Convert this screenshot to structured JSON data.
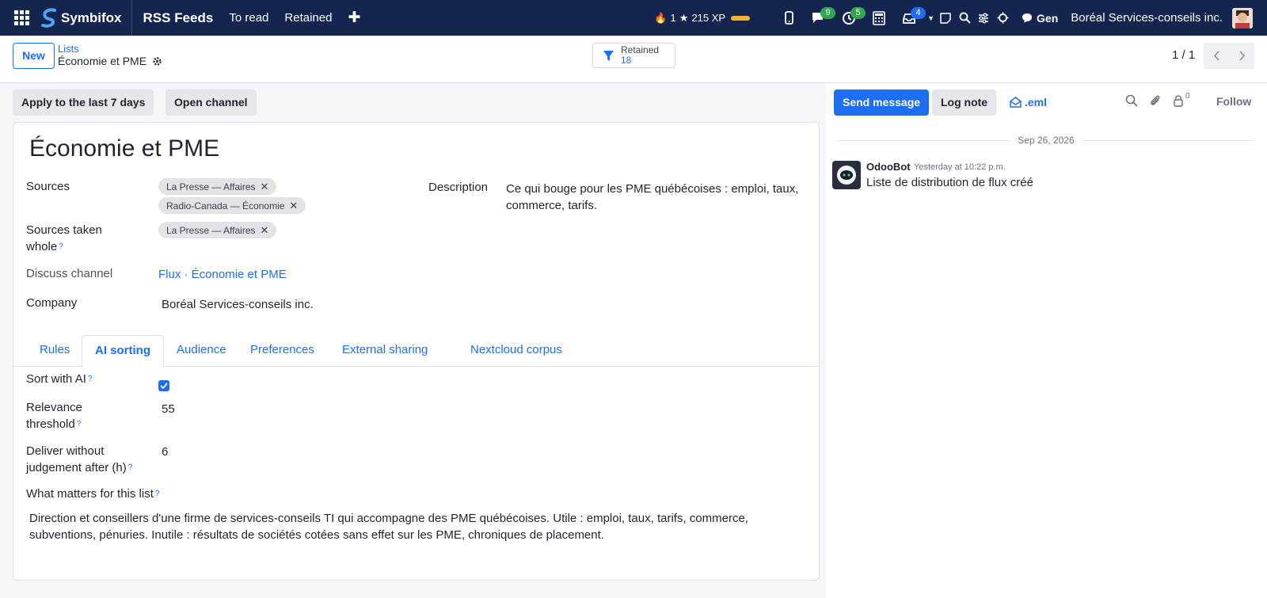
{
  "navbar": {
    "brand": "Symbifox",
    "app_name": "RSS Feeds",
    "menu": [
      "To read",
      "Retained"
    ],
    "gamification": {
      "streak": "1",
      "xp": "215 XP"
    },
    "chat_count": "9",
    "activity_count": "5",
    "notification_count": "4",
    "user_label": "Gen",
    "company": "Boréal Services-conseils inc."
  },
  "control": {
    "new_label": "New",
    "breadcrumb_parent": "Lists",
    "breadcrumb_current": "Économie et PME",
    "smart_label": "Retained",
    "smart_value": "18",
    "pager": "1 / 1"
  },
  "actions": {
    "apply": "Apply to the last 7 days",
    "open_channel": "Open channel"
  },
  "record": {
    "title": "Économie et PME",
    "sources_label": "Sources",
    "sources": [
      "La Presse — Affaires",
      "Radio-Canada — Économie"
    ],
    "whole_label_1": "Sources taken",
    "whole_label_2": "whole",
    "whole_sources": [
      "La Presse — Affaires"
    ],
    "channel_label": "Discuss channel",
    "channel_value": "Flux · Économie et PME",
    "company_label": "Company",
    "company_value": "Boréal Services-conseils inc.",
    "description_label": "Description",
    "description_value": "Ce qui bouge pour les PME québécoises : emploi, taux, commerce, tarifs."
  },
  "tabs": [
    "Rules",
    "AI sorting",
    "Audience",
    "Preferences",
    "External sharing",
    "Nextcloud corpus"
  ],
  "ai": {
    "sort_label": "Sort with AI",
    "threshold_label_1": "Relevance",
    "threshold_label_2": "threshold",
    "threshold_value": "55",
    "deliver_label_1": "Deliver without",
    "deliver_label_2": "judgement after (h)",
    "deliver_value": "6",
    "matters_label": "What matters for this list",
    "matters_value": "Direction et conseillers d'une firme de services-conseils TI qui accompagne des PME québécoises. Utile : emploi, taux, tarifs, commerce, subventions, pénuries. Inutile : résultats de sociétés cotées sans effet sur les PME, chroniques de placement."
  },
  "chatter": {
    "send": "Send message",
    "log": "Log note",
    "eml": ".eml",
    "followers": "0",
    "follow": "Follow",
    "date": "Sep 26, 2026",
    "author": "OdooBot",
    "time": "Yesterday at 10:22 p.m.",
    "body": "Liste de distribution de flux créé"
  },
  "help_mark": "?",
  "colors": {
    "navbar": "#14264f",
    "accent": "#1c6ff2",
    "badge_green": "#2fa84f"
  }
}
